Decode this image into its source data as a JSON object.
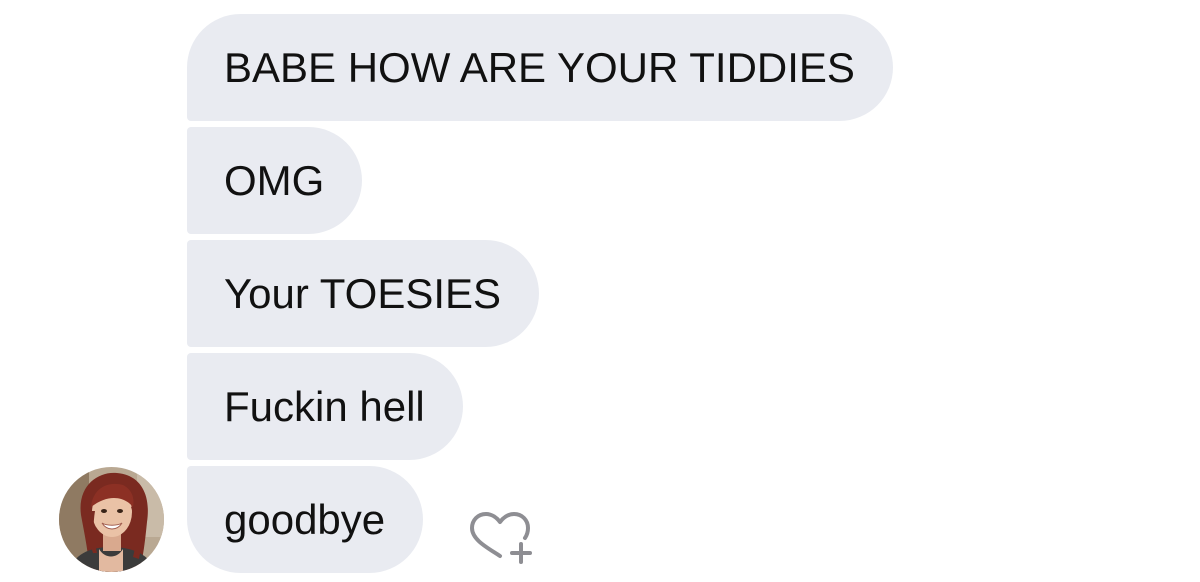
{
  "conversation": {
    "messages": [
      {
        "text": "BABE HOW ARE YOUR TIDDIES"
      },
      {
        "text": "OMG"
      },
      {
        "text": "Your TOESIES"
      },
      {
        "text": "Fuckin hell"
      },
      {
        "text": "goodbye"
      }
    ],
    "react_icon": "heart-plus-icon",
    "bubble_color": "#e9ebf1"
  }
}
